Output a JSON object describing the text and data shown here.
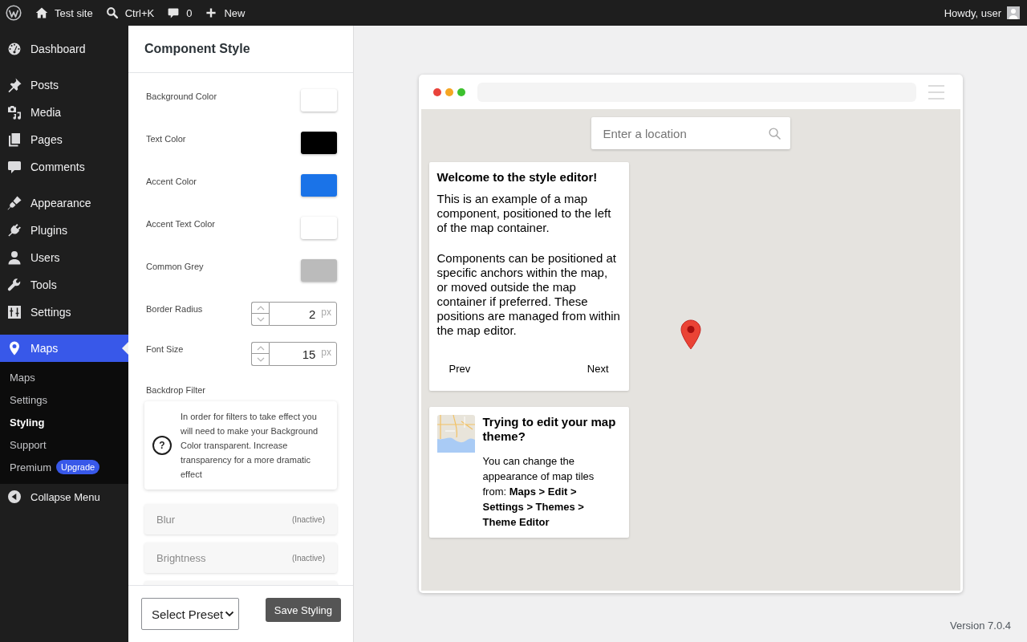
{
  "admin_bar": {
    "site": "Test site",
    "search_hint": "Ctrl+K",
    "comments": "0",
    "new": "New",
    "greeting": "Howdy, user"
  },
  "sidebar": {
    "groups": [
      {
        "items": [
          {
            "label": "Dashboard",
            "selected": false
          }
        ]
      },
      {
        "items": [
          {
            "label": "Posts",
            "selected": false
          },
          {
            "label": "Media",
            "selected": false
          },
          {
            "label": "Pages",
            "selected": false
          },
          {
            "label": "Comments",
            "selected": false
          }
        ]
      },
      {
        "items": [
          {
            "label": "Appearance",
            "selected": false
          },
          {
            "label": "Plugins",
            "selected": false
          },
          {
            "label": "Users",
            "selected": false
          },
          {
            "label": "Tools",
            "selected": false
          },
          {
            "label": "Settings",
            "selected": false
          }
        ]
      },
      {
        "items": [
          {
            "label": "Maps",
            "selected": true,
            "children": [
              {
                "label": "Maps",
                "selected": false
              },
              {
                "label": "Settings",
                "selected": false
              },
              {
                "label": "Styling",
                "selected": true
              },
              {
                "label": "Support",
                "selected": false
              },
              {
                "label": "Premium",
                "selected": false,
                "badge": "Upgrade"
              }
            ]
          }
        ]
      }
    ],
    "collapse": "Collapse Menu"
  },
  "panel": {
    "title": "Component Style",
    "fields": [
      {
        "kind": "color",
        "label": "Background Color",
        "color": "#ffffff"
      },
      {
        "kind": "color",
        "label": "Text Color",
        "color": "#000000"
      },
      {
        "kind": "color",
        "label": "Accent Color",
        "color": "#1a73e8"
      },
      {
        "kind": "color",
        "label": "Accent Text Color",
        "color": "#ffffff"
      },
      {
        "kind": "color",
        "label": "Common Grey",
        "color": "#bbbbbb"
      },
      {
        "kind": "number",
        "label": "Border Radius",
        "value": "2",
        "unit": "px"
      },
      {
        "kind": "number",
        "label": "Font Size",
        "value": "15",
        "unit": "px"
      }
    ],
    "backdrop": {
      "label": "Backdrop Filter",
      "notice_icon": "?",
      "notice": "In order for filters to take effect you will need to make your Background Color transparent. Increase transparency for a more dramatic effect",
      "filters": [
        {
          "label": "Blur",
          "status": "(Inactive)"
        },
        {
          "label": "Brightness",
          "status": "(Inactive)"
        }
      ],
      "more_below": true
    },
    "preset": {
      "value": "Select Preset"
    },
    "save": "Save Styling"
  },
  "preview": {
    "search": {
      "placeholder": "Enter a location"
    },
    "welcome": {
      "title": "Welcome to the style editor!",
      "paragraphs": [
        "This is an example of a map component, positioned to the left of the map container.",
        "Components can be positioned at specific anchors within the map, or moved outside the map container if preferred. These positions are managed from within the map editor."
      ],
      "prev": "Prev",
      "next": "Next"
    },
    "theme_tip": {
      "title": "Trying to edit your map theme?",
      "body": "You can change the appearance of map tiles from: **Maps > Edit > Settings > Themes > Theme Editor**"
    }
  },
  "version": "Version 7.0.4"
}
